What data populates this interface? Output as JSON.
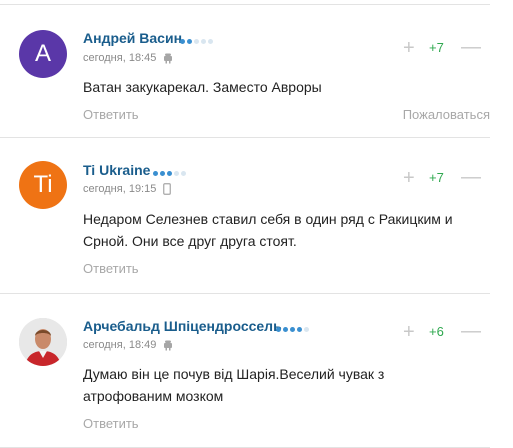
{
  "comments": [
    {
      "avatar_letter": "А",
      "avatar_color": "#5a37a8",
      "author": "Андрей Васин",
      "rating_dots_on": 2,
      "time": "сегодня, 18:45",
      "device": "android-icon",
      "text": "Ватан закукарекал. Заместо Авроры",
      "reply_label": "Ответить",
      "report_label": "Пожаловаться",
      "score": "+7"
    },
    {
      "avatar_letter": "Ti",
      "avatar_color": "#ef7314",
      "author": "Ti Ukraine",
      "rating_dots_on": 3,
      "time": "сегодня, 19:15",
      "device": "phone-icon",
      "text": "Недаром Селезнев ставил себя в один ряд с Ракицким и Срной. Они все друг друга стоят.",
      "reply_label": "Ответить",
      "score": "+7"
    },
    {
      "avatar_letter": "",
      "avatar_color": "#d9d9d9",
      "author": "Арчебальд Шпіцендроссель",
      "rating_dots_on": 4,
      "time": "сегодня, 18:49",
      "device": "android-icon",
      "text": "Думаю він це почув від Шарія.Веселий чувак з атрофованим мозком",
      "reply_label": "Ответить",
      "score": "+6"
    }
  ],
  "vote_up_symbol": "+",
  "vote_down_symbol": "—"
}
